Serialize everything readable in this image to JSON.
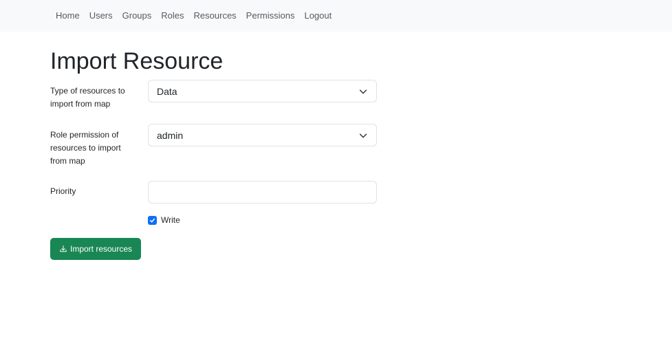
{
  "nav": {
    "items": [
      {
        "label": "Home"
      },
      {
        "label": "Users"
      },
      {
        "label": "Groups"
      },
      {
        "label": "Roles"
      },
      {
        "label": "Resources"
      },
      {
        "label": "Permissions"
      },
      {
        "label": "Logout"
      }
    ]
  },
  "page": {
    "title": "Import Resource"
  },
  "form": {
    "type_label": "Type of resources to import from map",
    "type_value": "Data",
    "role_label": "Role permission of resources to import from map",
    "role_value": "admin",
    "priority_label": "Priority",
    "priority_value": "",
    "write_label": "Write",
    "write_checked": true,
    "submit_label": "Import resources"
  },
  "colors": {
    "navbar_bg": "#f8f9fa",
    "primary_checkbox": "#0d6efd",
    "success_button": "#198754"
  },
  "icons": {
    "select_chevron": "chevron-down-icon",
    "checkbox_check": "check-icon",
    "button_icon": "download-icon"
  }
}
